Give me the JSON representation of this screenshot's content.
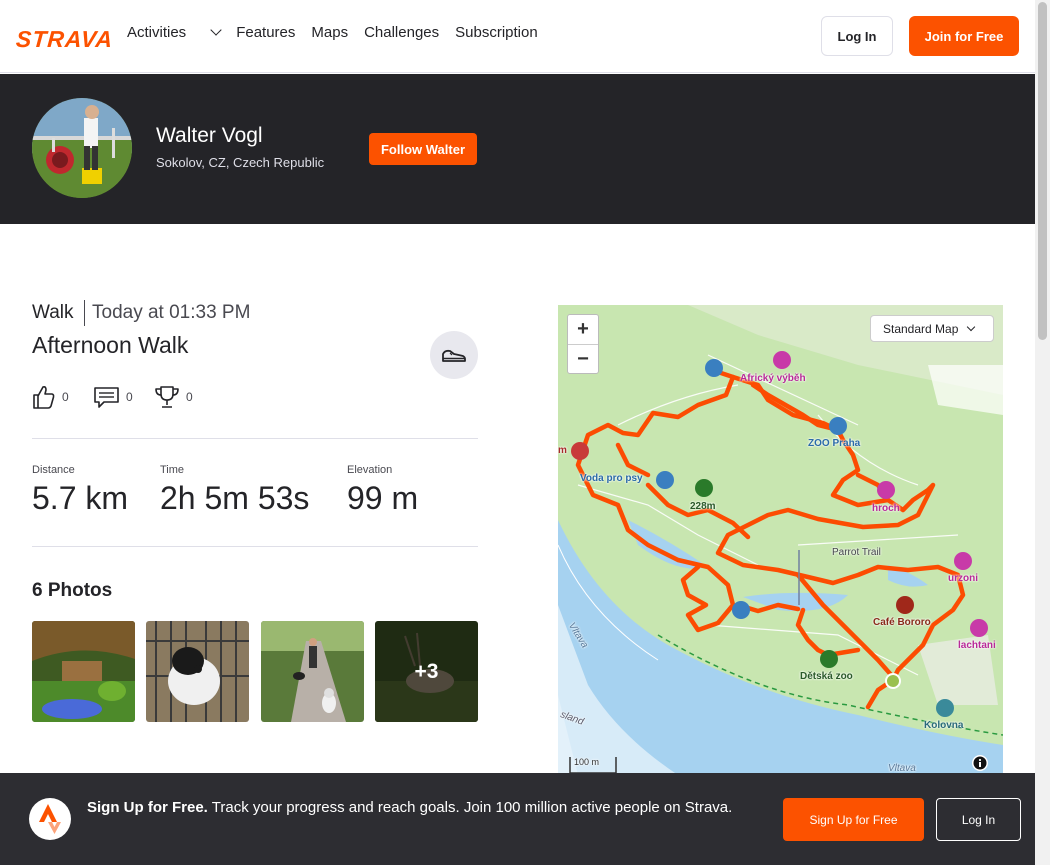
{
  "nav": {
    "logo": "STRAVA",
    "links": [
      "Activities",
      "Features",
      "Maps",
      "Challenges",
      "Subscription"
    ],
    "login": "Log In",
    "join": "Join for Free"
  },
  "athlete": {
    "name": "Walter Vogl",
    "location": "Sokolov, CZ, Czech Republic",
    "follow": "Follow Walter"
  },
  "activity": {
    "type": "Walk",
    "time": "Today at 01:33 PM",
    "title": "Afternoon Walk",
    "kudos": "0",
    "comments": "0",
    "achievements": "0",
    "stats": [
      {
        "label": "Distance",
        "value": "5.7 km"
      },
      {
        "label": "Time",
        "value": "2h 5m 53s"
      },
      {
        "label": "Elevation",
        "value": "99 m"
      }
    ],
    "photos_title": "6 Photos",
    "more_photos": "+3"
  },
  "map": {
    "style": "Standard Map",
    "zoom_in": "+",
    "zoom_out": "−",
    "scale": "100 m",
    "labels": {
      "africky": "Africký výběh",
      "zoo": "ZOO Praha",
      "voda": "Voda pro psy",
      "peak": "228m",
      "hroch": "hroch",
      "parrot": "Parrot Trail",
      "urzoni": "urzoni",
      "cafe": "Café Bororo",
      "lachtani": "lachtani",
      "detska": "Dětská zoo",
      "kolovna": "Kolovna",
      "vltava1": "Vltava",
      "vltava2": "Vltava",
      "island": "sland",
      "m": "m"
    }
  },
  "signup": {
    "lead": "Sign Up for Free.",
    "text": "Track your progress and reach goals. Join 100 million active people on Strava.",
    "button": "Sign Up for Free",
    "login": "Log In"
  },
  "colors": {
    "brand": "#fc5200",
    "route": "#fc4c02",
    "banner": "#242428"
  }
}
